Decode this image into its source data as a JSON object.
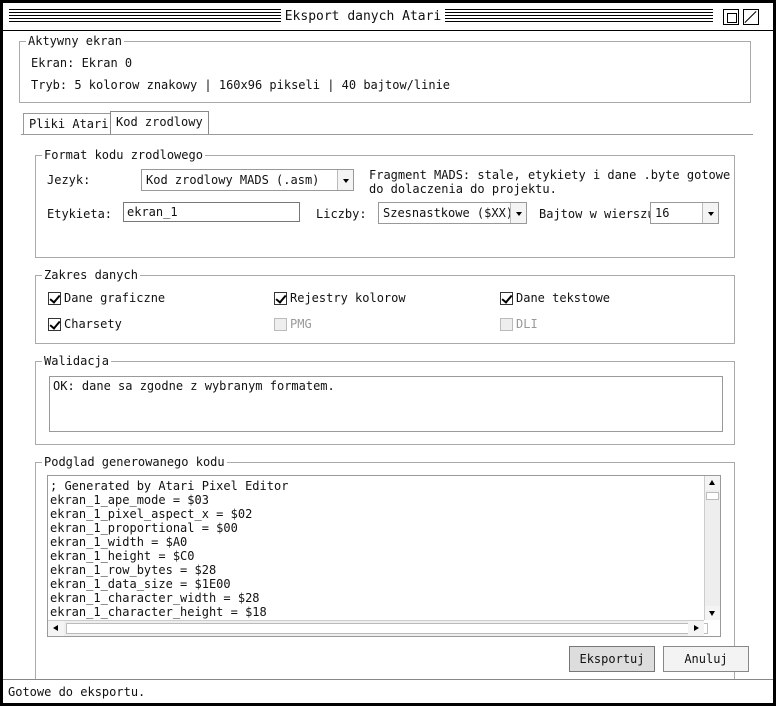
{
  "window": {
    "title": "Eksport danych Atari"
  },
  "active_screen": {
    "legend": "Aktywny ekran",
    "screen_line": "Ekran: Ekran 0",
    "mode_line": "Tryb: 5 kolorow znakowy | 160x96 pikseli | 40 bajtow/linie"
  },
  "tabs": [
    {
      "label": "Pliki Atari",
      "active": false
    },
    {
      "label": "Kod zrodlowy",
      "active": true
    }
  ],
  "format": {
    "legend": "Format kodu zrodlowego",
    "language_label": "Jezyk:",
    "language_value": "Kod zrodlowy MADS (.asm)",
    "description": [
      "Fragment MADS: stale, etykiety i dane .byte gotowe",
      "do dolaczenia do projektu."
    ],
    "label_label": "Etykieta:",
    "label_value": "ekran_1",
    "numbers_label": "Liczby:",
    "numbers_value": "Szesnastkowe ($XX)",
    "bytes_label": "Bajtow w wierszu",
    "bytes_value": "16"
  },
  "range": {
    "legend": "Zakres danych",
    "items": [
      {
        "label": "Dane graficzne",
        "checked": true,
        "enabled": true
      },
      {
        "label": "Rejestry kolorow",
        "checked": true,
        "enabled": true
      },
      {
        "label": "Dane tekstowe",
        "checked": true,
        "enabled": true
      },
      {
        "label": "Charsety",
        "checked": true,
        "enabled": true
      },
      {
        "label": "PMG",
        "checked": false,
        "enabled": false
      },
      {
        "label": "DLI",
        "checked": false,
        "enabled": false
      }
    ]
  },
  "validation": {
    "legend": "Walidacja",
    "message": "OK: dane sa zgodne z wybranym formatem."
  },
  "preview": {
    "legend": "Podglad generowanego kodu",
    "lines": [
      "; Generated by Atari Pixel Editor",
      "ekran_1_ape_mode = $03",
      "ekran_1_pixel_aspect_x = $02",
      "ekran_1_proportional = $00",
      "ekran_1_width = $A0",
      "ekran_1_height = $C0",
      "ekran_1_row_bytes = $28",
      "ekran_1_data_size = $1E00",
      "ekran_1_character_width = $28",
      "ekran_1_character_height = $18"
    ]
  },
  "buttons": {
    "export": "Eksportuj",
    "cancel": "Anuluj"
  },
  "status": "Gotowe do eksportu."
}
